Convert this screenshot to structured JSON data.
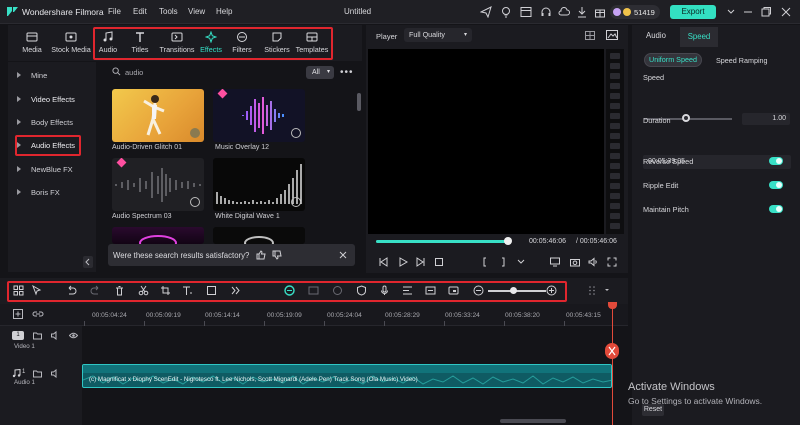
{
  "app": {
    "name": "Wondershare Filmora",
    "document_title": "Untitled"
  },
  "menu": [
    "File",
    "Edit",
    "Tools",
    "View",
    "Help"
  ],
  "credits": "51419",
  "export_label": "Export",
  "media_tabs": [
    {
      "label": "Media",
      "icon": "media-icon"
    },
    {
      "label": "Stock Media",
      "icon": "stock-media-icon"
    },
    {
      "label": "Audio",
      "icon": "audio-icon"
    },
    {
      "label": "Titles",
      "icon": "titles-icon"
    },
    {
      "label": "Transitions",
      "icon": "transitions-icon"
    },
    {
      "label": "Effects",
      "icon": "effects-icon",
      "active": true
    },
    {
      "label": "Filters",
      "icon": "filters-icon"
    },
    {
      "label": "Stickers",
      "icon": "stickers-icon"
    },
    {
      "label": "Templates",
      "icon": "templates-icon"
    }
  ],
  "left_nav": [
    "Mine",
    "Video Effects",
    "Body Effects",
    "Audio Effects",
    "NewBlue FX",
    "Boris FX"
  ],
  "search": {
    "value": "audio",
    "filter": "All"
  },
  "effects": [
    {
      "label": "Audio-Driven Glitch 01"
    },
    {
      "label": "Music Overlay 12"
    },
    {
      "label": "Audio Spectrum 03"
    },
    {
      "label": "White Digital Wave 1"
    }
  ],
  "feedback": {
    "text": "Were these search results satisfactory?"
  },
  "player": {
    "label": "Player",
    "quality": "Full Quality",
    "current_time": "00:05:46:06",
    "total_time": "/ 00:05:46:06",
    "progress": 1.0
  },
  "right_panel": {
    "tabs": [
      "Audio",
      "Speed"
    ],
    "speed_tabs": [
      "Uniform Speed",
      "Speed Ramping"
    ],
    "speed_label": "Speed",
    "speed_value": "1.00",
    "duration_label": "Duration",
    "duration_value": "00:05:39:05",
    "options": [
      "Reverse Speed",
      "Ripple Edit",
      "Maintain Pitch"
    ],
    "reset_label": "Reset"
  },
  "watermark": {
    "line1": "Activate Windows",
    "line2": "Go to Settings to activate Windows."
  },
  "ruler": [
    "00:05:04:24",
    "00:05:09:19",
    "00:05:14:14",
    "00:05:19:09",
    "00:05:24:04",
    "00:05:28:29",
    "00:05:33:24",
    "00:05:38:20",
    "00:05:43:15"
  ],
  "tracks": {
    "video_label": "Video 1",
    "audio_label": "Audio 1",
    "video_num": "1",
    "audio_num": "1"
  },
  "audio_clip_name": "(c) Magnificat x Diophy ScenEdit - Nigrotesco ft. Lee Nichols, Scott Mignardi (Adele Pen) Track Song (Ola Music) Video)",
  "colors": {
    "accent": "#38e0c6",
    "highlight": "#e0262e",
    "clip": "#0f5b63",
    "playhead": "#e24a3a"
  }
}
